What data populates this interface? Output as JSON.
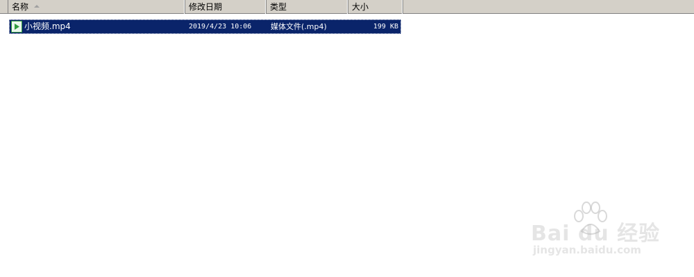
{
  "columns": {
    "name": "名称",
    "modified": "修改日期",
    "type": "类型",
    "size": "大小"
  },
  "files": [
    {
      "name": "小视频.mp4",
      "modified": "2019/4/23 10:06",
      "type": "媒体文件(.mp4)",
      "size": "199 KB",
      "icon": "media-file-icon",
      "selected": true
    }
  ],
  "watermark": {
    "logo": "Bai du 经验",
    "url": "jingyan.baidu.com"
  },
  "colors": {
    "header_bg": "#d4d0c8",
    "selection_bg": "#0a246a",
    "icon_green": "#2e9a3c"
  }
}
